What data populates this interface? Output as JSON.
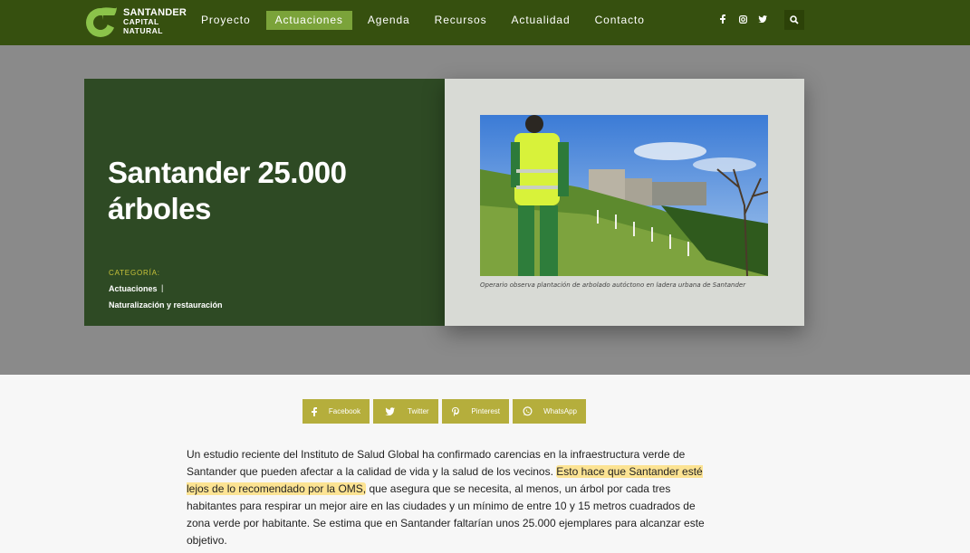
{
  "brand": {
    "line1": "SANTANDER",
    "line2": "CAPITAL",
    "line3": "NATURAL"
  },
  "nav": {
    "items": [
      {
        "label": "Proyecto",
        "active": false
      },
      {
        "label": "Actuaciones",
        "active": true
      },
      {
        "label": "Agenda",
        "active": false
      },
      {
        "label": "Recursos",
        "active": false
      },
      {
        "label": "Actualidad",
        "active": false
      },
      {
        "label": "Contacto",
        "active": false
      }
    ],
    "social_icons": [
      "facebook-icon",
      "instagram-icon",
      "twitter-icon"
    ],
    "search_icon": "search-icon"
  },
  "hero": {
    "title": "Santander 25.000 árboles",
    "category_label": "CATEGORÍA:",
    "categories": [
      "Actuaciones",
      "Naturalización y restauración"
    ],
    "category_separator": "|",
    "caption": "Operario observa plantación de arbolado autóctono en ladera urbana de Santander"
  },
  "share": {
    "buttons": [
      {
        "label": "Facebook",
        "icon": "facebook-icon"
      },
      {
        "label": "Twitter",
        "icon": "twitter-icon"
      },
      {
        "label": "Pinterest",
        "icon": "pinterest-icon"
      },
      {
        "label": "WhatsApp",
        "icon": "whatsapp-icon"
      }
    ]
  },
  "article": {
    "part1": "Un estudio reciente del Instituto de Salud Global ha confirmado carencias en la infraestructura verde de Santander que pueden afectar a la calidad de vida y la salud de los vecinos. ",
    "highlight": "Esto hace que Santander esté lejos de lo recomendado por la OMS,",
    "part2": " que asegura que se necesita, al menos, un árbol por cada tres habitantes para respirar un mejor aire en las ciudades y un mínimo de entre 10 y 15 metros cuadrados de zona verde por habitante. Se estima que en Santander faltarían unos 25.000 ejemplares para alcanzar este objetivo."
  },
  "colors": {
    "nav_bg": "#36500f",
    "nav_active": "#7ba33a",
    "hero_panel": "#2e4a24",
    "share_btn": "#b5ae3c",
    "category_label": "#c9c33a"
  }
}
